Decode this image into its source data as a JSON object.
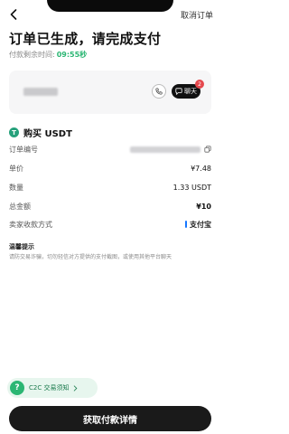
{
  "header": {
    "cancel_label": "取消订单"
  },
  "title": "订单已生成，请完成支付",
  "countdown": {
    "label": "付款剩余时间:",
    "time": "09:55秒"
  },
  "merchant": {
    "chat_label": "聊天",
    "unread_count": "2"
  },
  "order": {
    "section_title": "购买 USDT",
    "rows": {
      "order_no": {
        "label": "订单编号"
      },
      "price": {
        "label": "单价",
        "value": "¥7.48"
      },
      "quantity": {
        "label": "数量",
        "value": "1.33 USDT"
      },
      "total": {
        "label": "总金额",
        "value": "¥10"
      },
      "payment": {
        "label": "卖家收款方式",
        "value": "支付宝"
      }
    }
  },
  "tips": {
    "title": "温馨提示",
    "body": "请防交易诈骗，切勿轻信对方提供的支付截图，或使用其他平台聊天"
  },
  "c2c": {
    "label": "C2C 交易须知"
  },
  "primary_button": {
    "label": "获取付款详情"
  },
  "colors": {
    "accent_green": "#2bb673",
    "usdt_green": "#26a17b",
    "alipay_blue": "#1677ff",
    "badge_red": "#e5484d",
    "button_dark": "#1a1a1a"
  },
  "icons": {
    "back": "chevron-left-icon",
    "phone": "phone-icon",
    "chat": "chat-bubble-icon",
    "usdt": "usdt-icon",
    "copy": "copy-icon",
    "c2c": "question-mark-icon",
    "c2c_arrow": "chevron-right-icon"
  }
}
